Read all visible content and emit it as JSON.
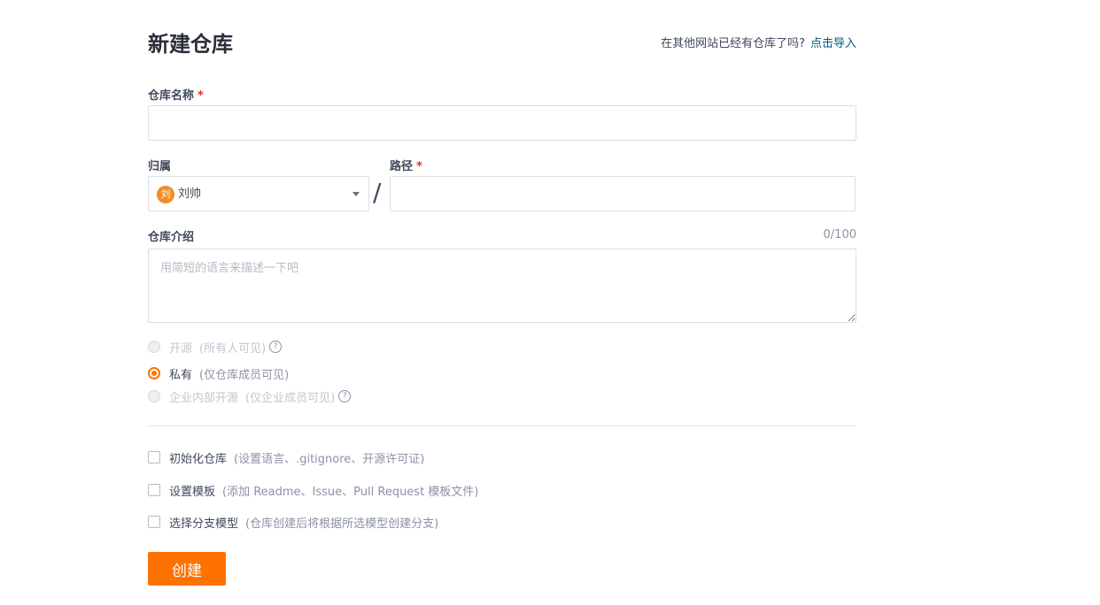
{
  "page": {
    "title": "新建仓库",
    "import_tip": "在其他网站已经有仓库了吗?",
    "import_link": "点击导入"
  },
  "repo_name": {
    "label": "仓库名称",
    "required_mark": "*",
    "value": ""
  },
  "owner": {
    "label": "归属",
    "avatar_char": "刘",
    "name": "刘帅"
  },
  "separator": "/",
  "path": {
    "label": "路径",
    "required_mark": "*",
    "value": ""
  },
  "description": {
    "label": "仓库介绍",
    "counter": "0/100",
    "placeholder": "用简短的语言来描述一下吧"
  },
  "visibility": [
    {
      "label": "开源",
      "hint": "(所有人可见)",
      "state": "disabled",
      "help": "?"
    },
    {
      "label": "私有",
      "hint": "(仅仓库成员可见)",
      "state": "checked"
    },
    {
      "label": "企业内部开源",
      "hint": "(仅企业成员可见)",
      "state": "disabled",
      "help": "?"
    }
  ],
  "options": [
    {
      "label": "初始化仓库",
      "hint": "(设置语言、.gitignore、开源许可证)",
      "checked": false
    },
    {
      "label": "设置模板",
      "hint": "(添加 Readme、Issue、Pull Request 模板文件)",
      "checked": false
    },
    {
      "label": "选择分支模型",
      "hint": "(仓库创建后将根据所选模型创建分支)",
      "checked": false
    }
  ],
  "submit_label": "创建",
  "colors": {
    "accent": "#fe7300",
    "link": "#005980",
    "required": "#e12d2d",
    "avatar": "#f28c28"
  }
}
